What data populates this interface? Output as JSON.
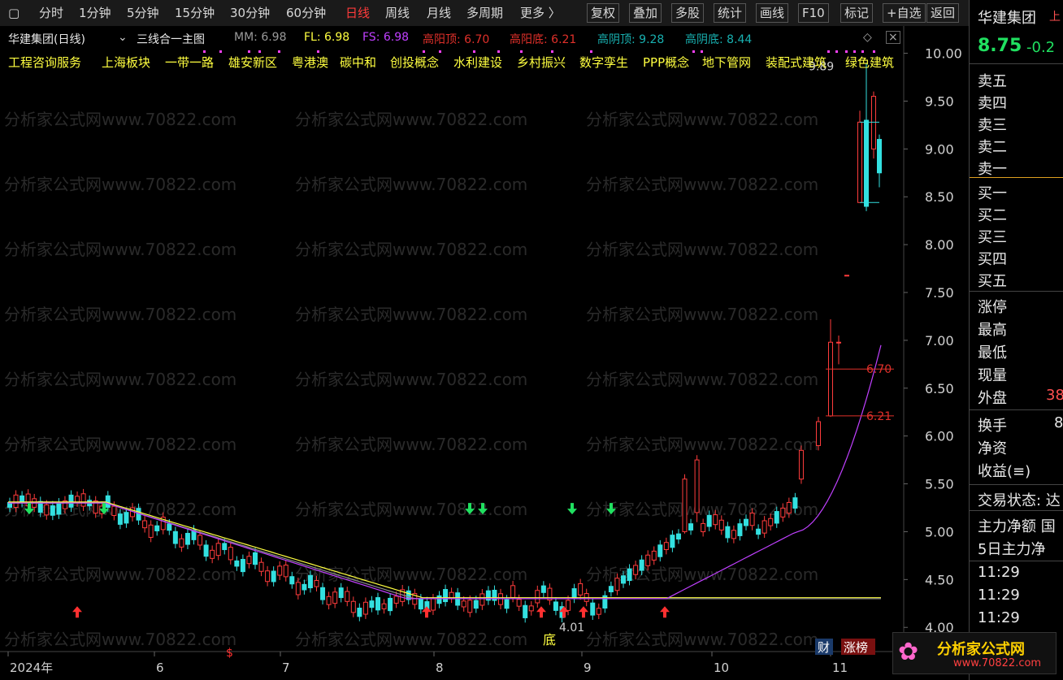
{
  "toolbar": {
    "items": [
      "分时",
      "1分钟",
      "5分钟",
      "15分钟",
      "30分钟",
      "60分钟",
      "日线",
      "周线",
      "月线",
      "多周期",
      "更多 〉"
    ],
    "active": "日线",
    "right_items": [
      "复权",
      "叠加",
      "多股",
      "统计",
      "画线",
      "F10",
      "标记",
      "+自选",
      "返回"
    ]
  },
  "header": {
    "stock_name": "华建集团(日线)",
    "formula": "三线合一主图",
    "mm": "MM: 6.98",
    "fl": "FL: 6.98",
    "fs": "FS: 6.98",
    "gyd": "高阳顶: 6.70",
    "gydi": "高阳底: 6.21",
    "gyind": "高阴顶: 9.28",
    "gyindi": "高阴底: 8.44",
    "colors": {
      "mm": "#9a9a9a",
      "fl": "#ffff40",
      "fs": "#c040ff",
      "red": "#e0302a",
      "cyan": "#18b0b0"
    }
  },
  "tags": [
    "工程咨询服务",
    "上海板块",
    "一带一路",
    "雄安新区",
    "粤港澳",
    "碳中和",
    "创投概念",
    "水利建设",
    "乡村振兴",
    "数字孪生",
    "PPP概念",
    "地下管网",
    "装配式建筑",
    "绿色建筑"
  ],
  "watermark": "分析家公式网www.70822.com",
  "chart_data": {
    "type": "candlestick",
    "y_ticks": [
      "10.00",
      "9.50",
      "9.00",
      "8.50",
      "8.00",
      "7.50",
      "7.00",
      "6.50",
      "6.00",
      "5.50",
      "5.00",
      "4.50",
      "4.00"
    ],
    "ylim": [
      3.9,
      10.2
    ],
    "x_ticks": [
      "2024年",
      "6",
      "7",
      "8",
      "9",
      "10",
      "11"
    ],
    "annotations": {
      "high": "9.89",
      "low": "4.01",
      "bottom_label": "底",
      "level1": "6.70",
      "level2": "6.21",
      "s_label": "$"
    },
    "bottom_badges": [
      "财",
      "涨榜"
    ]
  },
  "right_panel": {
    "name": "华建集团",
    "name_suffix": "上",
    "price": "8.75",
    "change": "-0.2",
    "sell_levels": [
      "卖五",
      "卖四",
      "卖三",
      "卖二",
      "卖一"
    ],
    "buy_levels": [
      "买一",
      "买二",
      "买三",
      "买四",
      "买五"
    ],
    "stats": [
      "涨停",
      "最高",
      "最低",
      "现量",
      "外盘"
    ],
    "outer_value": "38",
    "stats2": [
      "换手",
      "净资",
      "收益(≡)"
    ],
    "stats2_value": "8",
    "trade_status": "交易状态: 达",
    "flow": [
      "主力净额 国",
      "5日主力净"
    ],
    "times": [
      "11:29",
      "11:29",
      "11:29"
    ]
  },
  "logo": {
    "text": "分析家公式网",
    "url": "www.70822.com"
  }
}
